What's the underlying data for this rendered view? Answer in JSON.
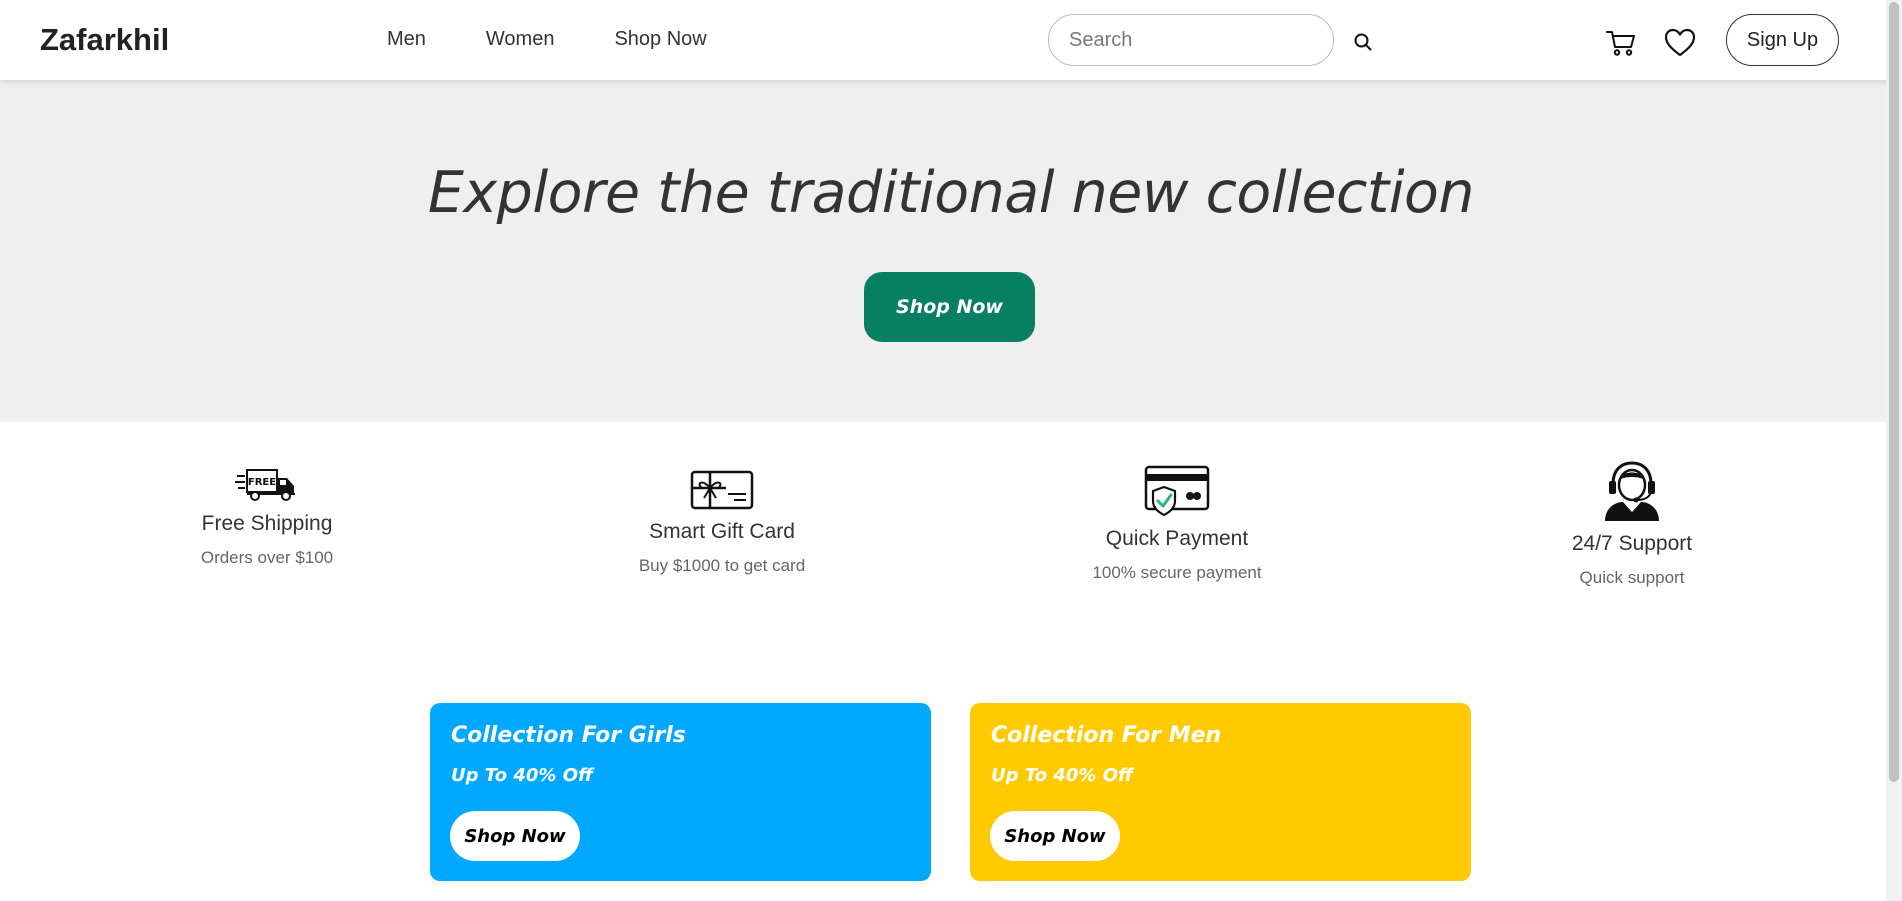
{
  "header": {
    "brand": "Zafarkhil",
    "nav": [
      "Men",
      "Women",
      "Shop Now"
    ],
    "search_placeholder": "Search",
    "signup_label": "Sign Up"
  },
  "hero": {
    "title": "Explore the traditional new collection",
    "button_label": "Shop Now",
    "button_color": "#067f63",
    "background": "#efefef"
  },
  "features": [
    {
      "icon": "free-shipping-truck-icon",
      "title": "Free Shipping",
      "subtitle": "Orders over $100",
      "icon_text": "FREE"
    },
    {
      "icon": "gift-card-icon",
      "title": "Smart Gift Card",
      "subtitle": "Buy $1000 to get card"
    },
    {
      "icon": "secure-payment-card-icon",
      "title": "Quick Payment",
      "subtitle": "100% secure payment"
    },
    {
      "icon": "support-agent-icon",
      "title": "24/7 Support",
      "subtitle": "Quick support"
    }
  ],
  "promos": [
    {
      "title": "Collection For Girls",
      "subtitle": "Up To 40% Off",
      "button_label": "Shop Now",
      "color": "#00a8ff"
    },
    {
      "title": "Collection For Men",
      "subtitle": "Up To 40% Off",
      "button_label": "Shop Now",
      "color": "#ffcb00"
    }
  ]
}
